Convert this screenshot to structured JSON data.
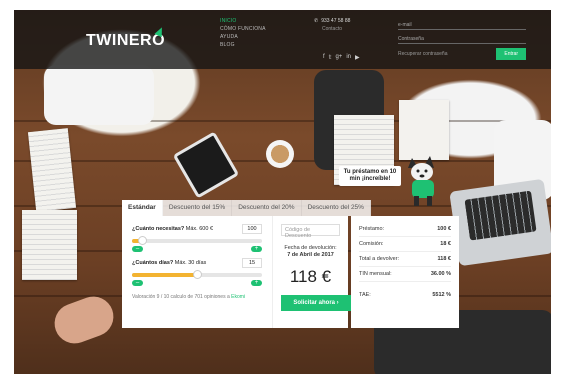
{
  "header": {
    "logo": "TWINERO",
    "nav": [
      "INICIO",
      "CÓMO FUNCIONA",
      "AYUDA",
      "BLOG"
    ],
    "phone": "933 47 58 88",
    "contact_label": "Contacto",
    "socials": [
      "f",
      "𝕥",
      "g+",
      "in",
      "▶"
    ],
    "email_placeholder": "e-mail",
    "password_placeholder": "Contraseña",
    "forgot_label": "Recuperar contraseña",
    "enter_label": "Entrar"
  },
  "bubble": {
    "line1": "Tu préstamo en 10",
    "line2": "min ¡increíble!"
  },
  "calculator": {
    "tabs": [
      "Estándar",
      "Descuento del 15%",
      "Descuento del 20%",
      "Descuento del 25%"
    ],
    "amount_question": "¿Cuánto necesitas?",
    "amount_max": "Máx. 600 €",
    "amount_value": "100",
    "amount_fraction": 0.08,
    "days_question": "¿Cuántos días?",
    "days_max": "Máx. 30 días",
    "days_value": "15",
    "days_fraction": 0.5,
    "rating_text": "Valoración 9 / 10 calculo de 701 opiniones a",
    "rating_link": "Ekomi",
    "promo_placeholder": "Código de Descuento",
    "due_label": "Fecha de devolución:",
    "due_date": "7 de Abril de 2017",
    "total": "118 €",
    "request_label": "Solicitar ahora  ›"
  },
  "summary": [
    {
      "label": "Préstamo:",
      "value": "100 €"
    },
    {
      "label": "Comisión:",
      "value": "18 €"
    },
    {
      "label": "Total a devolver:",
      "value": "118 €"
    },
    {
      "label": "TIN mensual:",
      "value": "36.00 %"
    },
    {
      "label": "TAE:",
      "value": "5512 %"
    }
  ],
  "colors": {
    "accent": "#1ec173",
    "slider": "#f3b331"
  }
}
